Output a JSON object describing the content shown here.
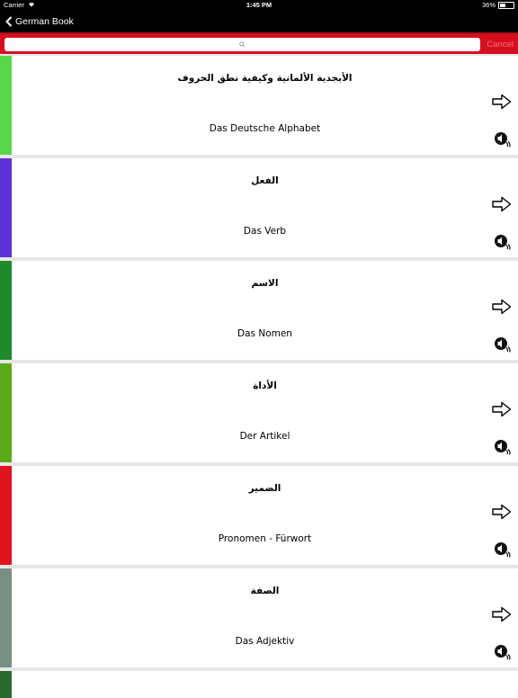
{
  "status": {
    "carrier": "Carrier",
    "time": "1:45 PM",
    "battery": "36%"
  },
  "nav": {
    "back_label": "German Book"
  },
  "search": {
    "placeholder": "",
    "cancel_label": "Cancel"
  },
  "lessons": [
    {
      "arabic": "الأبجدية الألمانية وكيفية نطق الحروف",
      "german": "Das Deutsche Alphabet",
      "color": "#5ad64a"
    },
    {
      "arabic": "الفعل",
      "german": "Das Verb",
      "color": "#5b33d8"
    },
    {
      "arabic": "الاسم",
      "german": "Das Nomen",
      "color": "#1e8a2a"
    },
    {
      "arabic": "الأداة",
      "german": "Der Artikel",
      "color": "#5aaa18"
    },
    {
      "arabic": "الضمير",
      "german": "Pronomen - Fürwort",
      "color": "#e0141e"
    },
    {
      "arabic": "الصفة",
      "german": "Das Adjektiv",
      "color": "#7a8f84"
    },
    {
      "arabic": "",
      "german": "",
      "color": "#2a6a30"
    }
  ],
  "icons": {
    "back": "chevron-left-icon",
    "search": "search-icon",
    "arrow": "arrow-right-icon",
    "audio": "speaker-icon",
    "wifi": "wifi-icon",
    "battery": "battery-icon"
  }
}
